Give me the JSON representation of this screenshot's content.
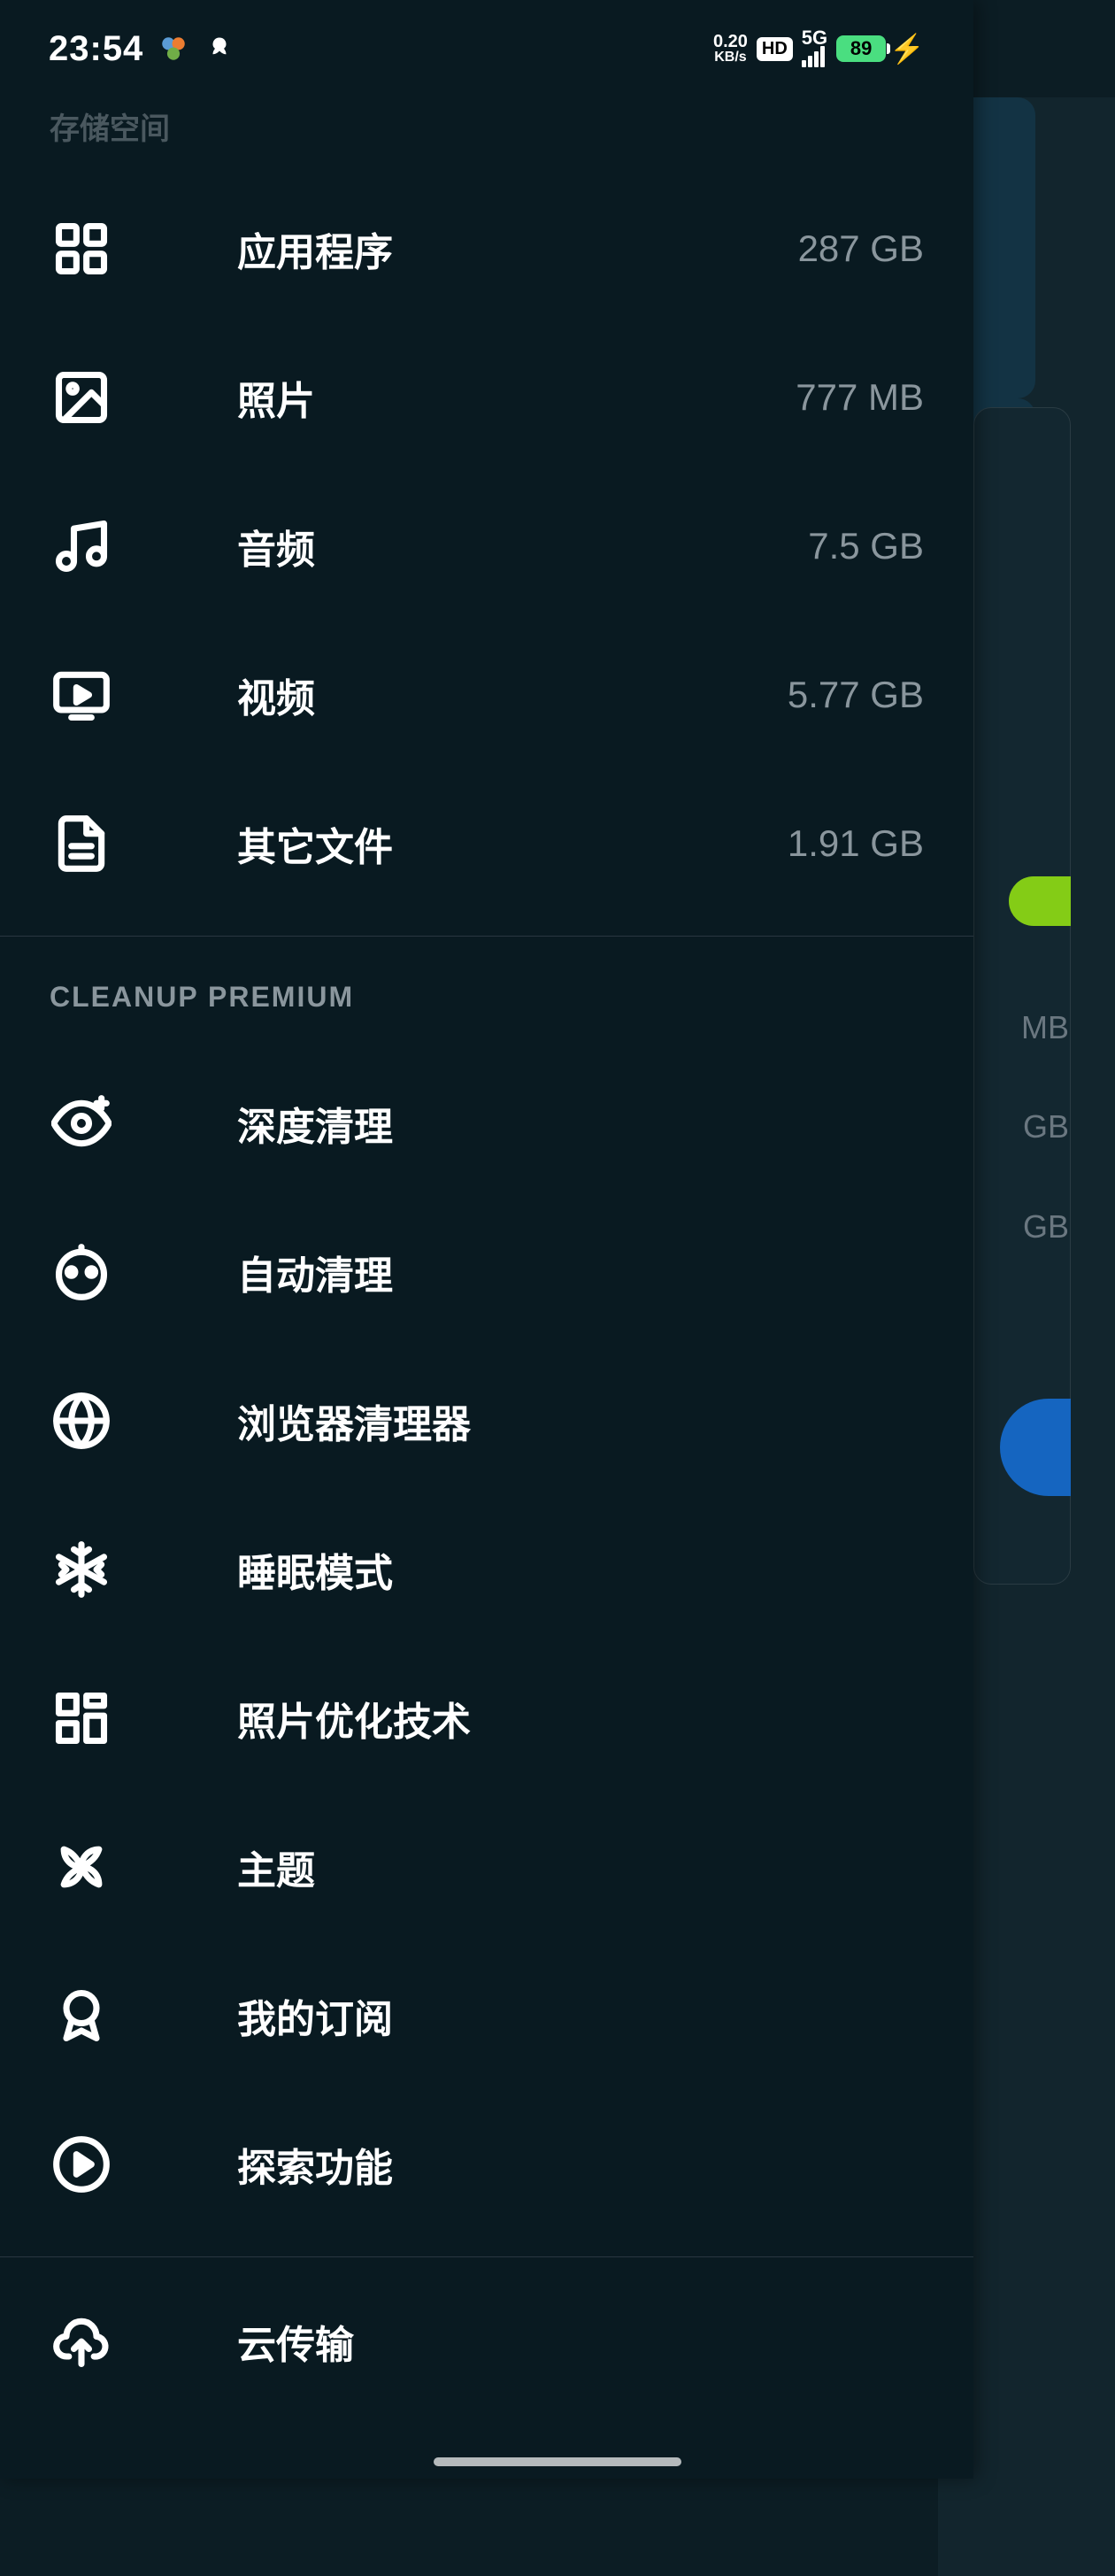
{
  "status": {
    "time": "23:54",
    "net_speed_top": "0.20",
    "net_speed_bottom": "KB/s",
    "hd": "HD",
    "net_type": "5G",
    "battery": "89"
  },
  "drawer": {
    "section_top_cut": "存储空间",
    "storage_items": [
      {
        "label": "应用程序",
        "value": "287 GB",
        "icon": "apps"
      },
      {
        "label": "照片",
        "value": "777 MB",
        "icon": "image"
      },
      {
        "label": "音频",
        "value": "7.5 GB",
        "icon": "music"
      },
      {
        "label": "视频",
        "value": "5.77 GB",
        "icon": "video"
      },
      {
        "label": "其它文件",
        "value": "1.91 GB",
        "icon": "file"
      }
    ],
    "section_premium": "CLEANUP PREMIUM",
    "premium_items": [
      {
        "label": "深度清理",
        "icon": "eye-plus"
      },
      {
        "label": "自动清理",
        "icon": "robot"
      },
      {
        "label": "浏览器清理器",
        "icon": "globe"
      },
      {
        "label": "睡眠模式",
        "icon": "snowflake"
      },
      {
        "label": "照片优化技术",
        "icon": "dashboard"
      },
      {
        "label": "主题",
        "icon": "pinwheel"
      },
      {
        "label": "我的订阅",
        "icon": "badge"
      },
      {
        "label": "探索功能",
        "icon": "play-circle"
      }
    ],
    "cloud_item": {
      "label": "云传输",
      "icon": "cloud-upload"
    }
  },
  "background": {
    "val1": "MB",
    "val2": "GB",
    "val3": "GB"
  }
}
